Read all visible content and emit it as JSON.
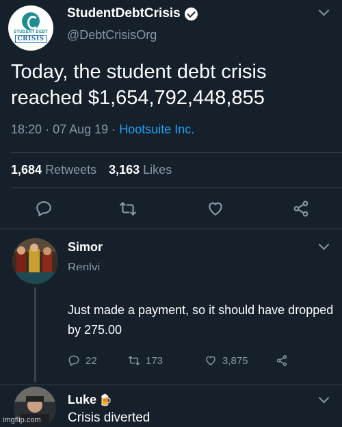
{
  "tweet": {
    "display_name": "StudentDebtCrisis",
    "handle": "@DebtCrisisOrg",
    "avatar_top_text": "STUDENT DEBT",
    "avatar_logo_text": "CRISIS",
    "text": "Today, the student debt crisis reached $1,654,792,448,855",
    "time": "18:20",
    "date": "07 Aug 19",
    "separator": "·",
    "source": "Hootsuite Inc.",
    "retweets_count": "1,684",
    "retweets_label": "Retweets",
    "likes_count": "3,163",
    "likes_label": "Likes"
  },
  "replies": [
    {
      "name": "Simor",
      "subtext": "Renlvi",
      "text": "Just made a payment, so it should have dropped by 275.00",
      "reply_count": "22",
      "retweet_count": "173",
      "like_count": "3,875"
    },
    {
      "name": "Luke",
      "name_emoji": "🍺",
      "text": "Crisis diverted"
    }
  ],
  "watermark": "imgflip.com",
  "colors": {
    "background": "#15202b",
    "secondary_text": "#8899a6",
    "link": "#1da1f2",
    "divider": "#38444d"
  },
  "icons": [
    "verified-icon",
    "chevron-down-icon",
    "reply-icon",
    "retweet-icon",
    "like-icon",
    "share-icon"
  ]
}
